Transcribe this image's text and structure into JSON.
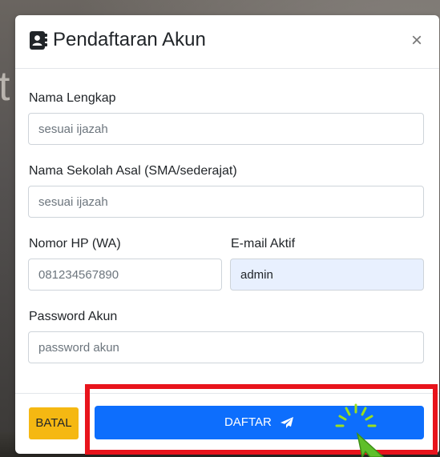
{
  "modal": {
    "title": "Pendaftaran Akun",
    "close_label": "×",
    "title_icon": "address-book-icon"
  },
  "form": {
    "nama_lengkap": {
      "label": "Nama Lengkap",
      "placeholder": "sesuai ijazah",
      "value": ""
    },
    "sekolah_asal": {
      "label": "Nama Sekolah Asal (SMA/sederajat)",
      "placeholder": "sesuai ijazah",
      "value": ""
    },
    "nomor_hp": {
      "label": "Nomor HP (WA)",
      "placeholder": "081234567890",
      "value": ""
    },
    "email": {
      "label": "E-mail Aktif",
      "placeholder": "",
      "value": "admin"
    },
    "password": {
      "label": "Password Akun",
      "placeholder": "password akun",
      "value": ""
    }
  },
  "footer": {
    "batal_label": "BATAL",
    "daftar_label": "DAFTAR",
    "daftar_icon": "paper-plane-icon"
  },
  "background": {
    "letter": "t"
  },
  "colors": {
    "primary": "#0d6efd",
    "warning": "#f5b812",
    "highlight": "#e8141c",
    "cursor": "#5fbf2a"
  }
}
